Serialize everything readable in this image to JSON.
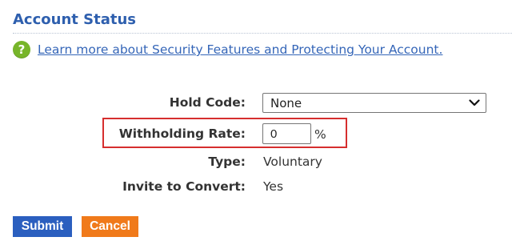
{
  "section": {
    "title": "Account Status",
    "help_link": "Learn more about Security Features and Protecting Your Account.",
    "help_icon": "question-mark-icon"
  },
  "form": {
    "hold_code": {
      "label": "Hold Code:",
      "selected": "None"
    },
    "withholding_rate": {
      "label": "Withholding Rate:",
      "value": "0",
      "unit": "%"
    },
    "type": {
      "label": "Type:",
      "value": "Voluntary"
    },
    "invite_to_convert": {
      "label": "Invite to Convert:",
      "value": "Yes"
    }
  },
  "buttons": {
    "submit": "Submit",
    "cancel": "Cancel"
  },
  "colors": {
    "title": "#2e5fae",
    "link": "#3566b8",
    "help_icon": "#77b52a",
    "highlight": "#d62e2e",
    "submit_bg": "#2b5fbf",
    "cancel_bg": "#f07a1a"
  }
}
